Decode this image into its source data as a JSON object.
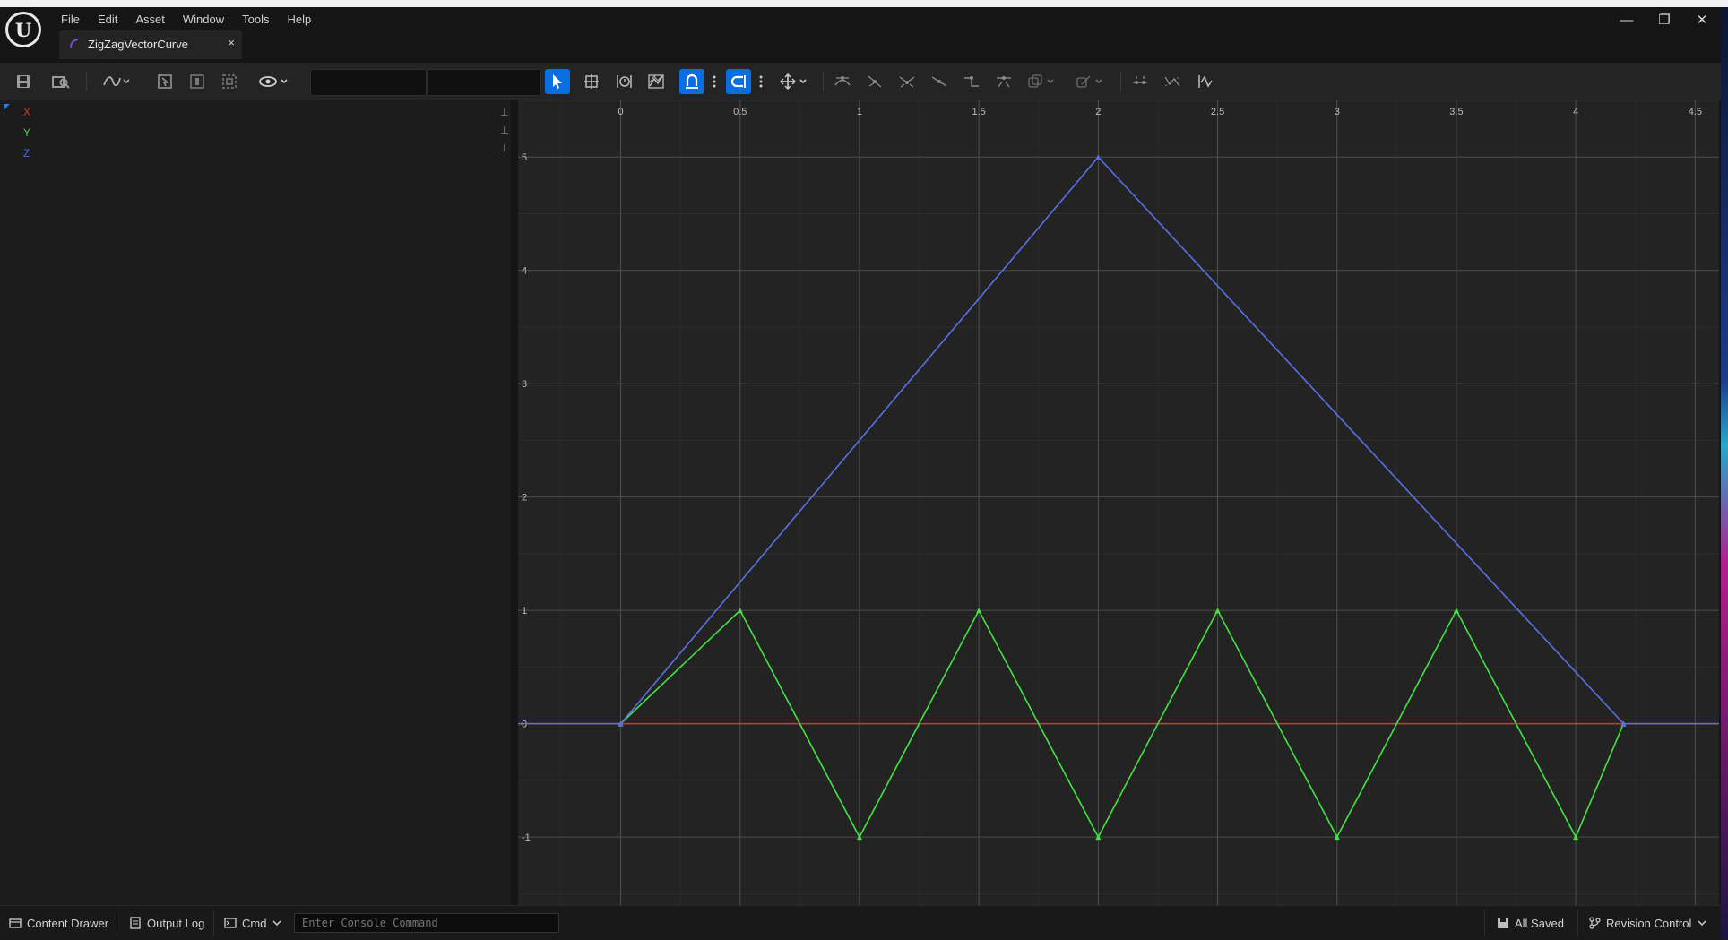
{
  "app": {
    "menu": [
      "File",
      "Edit",
      "Asset",
      "Window",
      "Tools",
      "Help"
    ],
    "tab_label": "ZigZagVectorCurve",
    "tab_close": "×",
    "window_controls": {
      "minimize": "—",
      "restore": "❐",
      "close": "✕"
    }
  },
  "toolbar": {
    "search_value": "",
    "filter_value": ""
  },
  "tree": {
    "items": [
      {
        "label": "X",
        "color": "#e03232"
      },
      {
        "label": "Y",
        "color": "#32e032"
      },
      {
        "label": "Z",
        "color": "#3c6cf0"
      }
    ]
  },
  "chart_data": {
    "type": "line",
    "x_ticks": [
      "0",
      "0.5",
      "1",
      "1.5",
      "2",
      "2.5",
      "3",
      "3.5",
      "4",
      "4.5"
    ],
    "y_ticks": [
      "5",
      "4",
      "3",
      "2",
      "1",
      "0",
      "-1"
    ],
    "xlim": [
      -0.43,
      4.6
    ],
    "ylim": [
      -1.6,
      5.5
    ],
    "series": [
      {
        "name": "X",
        "color": "#e03232",
        "x": [
          -0.43,
          0,
          4.2,
          4.6
        ],
        "y": [
          0,
          0,
          0,
          0
        ]
      },
      {
        "name": "Y",
        "color": "#44e344",
        "x": [
          0,
          0.5,
          1,
          1.5,
          2,
          2.5,
          3,
          3.5,
          4,
          4.2
        ],
        "y": [
          0,
          1,
          -1,
          1,
          -1,
          1,
          -1,
          1,
          -1,
          0
        ]
      },
      {
        "name": "Z",
        "color": "#5b6fe6",
        "x": [
          -0.43,
          0,
          2,
          4.2,
          4.6
        ],
        "y": [
          0,
          0,
          5,
          0,
          0
        ]
      }
    ]
  },
  "status": {
    "content_drawer": "Content Drawer",
    "output_log": "Output Log",
    "cmd": "Cmd",
    "console_placeholder": "Enter Console Command",
    "all_saved": "All Saved",
    "revision_control": "Revision Control"
  }
}
